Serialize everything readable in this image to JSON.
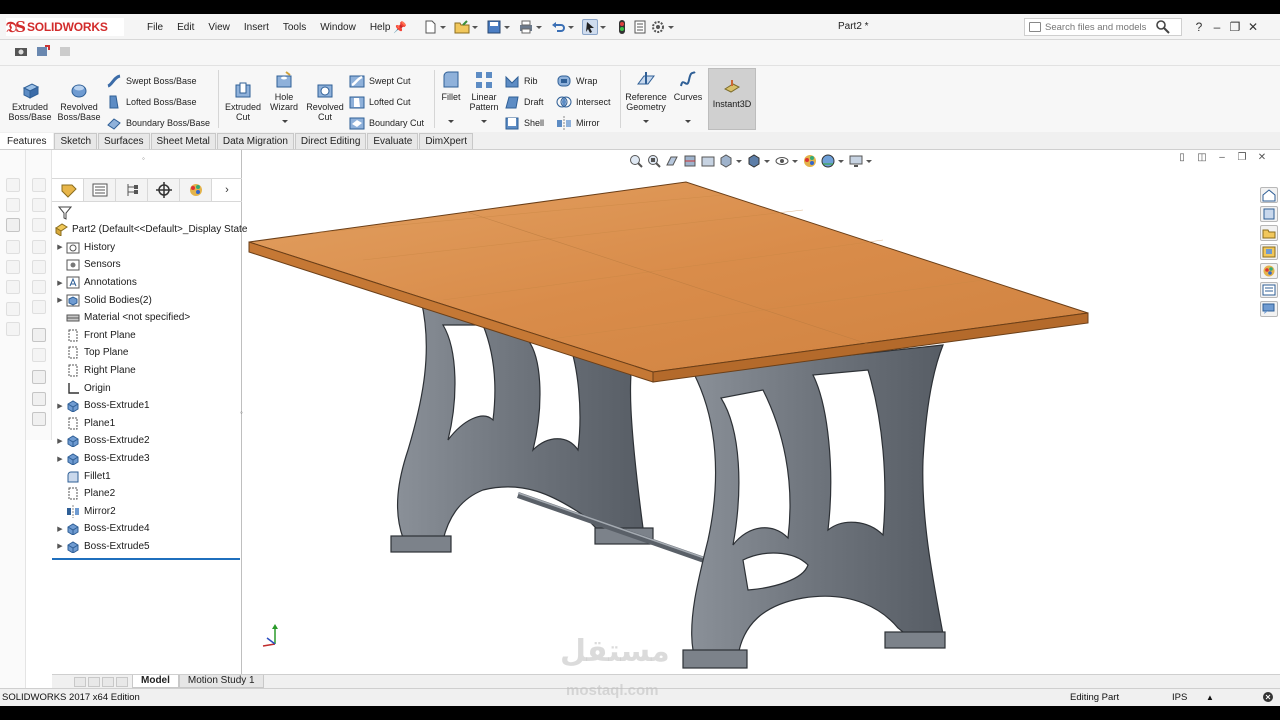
{
  "app": {
    "logo_text": "SOLIDWORKS",
    "document_title": "Part2 *"
  },
  "menu": [
    "File",
    "Edit",
    "View",
    "Insert",
    "Tools",
    "Window",
    "Help"
  ],
  "search": {
    "placeholder": "Search files and models"
  },
  "window_buttons": [
    "?",
    "–",
    "❐",
    "✕"
  ],
  "commands": {
    "extruded_boss": "Extruded Boss/Base",
    "revolved_boss": "Revolved Boss/Base",
    "swept_boss": "Swept Boss/Base",
    "lofted_boss": "Lofted Boss/Base",
    "boundary_boss": "Boundary Boss/Base",
    "extruded_cut": "Extruded Cut",
    "hole_wizard": "Hole Wizard",
    "revolved_cut": "Revolved Cut",
    "swept_cut": "Swept Cut",
    "lofted_cut": "Lofted Cut",
    "boundary_cut": "Boundary Cut",
    "fillet": "Fillet",
    "linear_pattern": "Linear Pattern",
    "rib": "Rib",
    "draft": "Draft",
    "shell": "Shell",
    "wrap": "Wrap",
    "intersect": "Intersect",
    "mirror": "Mirror",
    "reference_geometry": "Reference Geometry",
    "curves": "Curves",
    "instant3d": "Instant3D"
  },
  "tabs": [
    "Features",
    "Sketch",
    "Surfaces",
    "Sheet Metal",
    "Data Migration",
    "Direct Editing",
    "Evaluate",
    "DimXpert"
  ],
  "active_tab": "Features",
  "tree": {
    "root": "Part2  (Default<<Default>_Display State",
    "items": [
      {
        "label": "History",
        "expandable": true,
        "icon": "history-folder-icon"
      },
      {
        "label": "Sensors",
        "expandable": false,
        "icon": "sensor-icon"
      },
      {
        "label": "Annotations",
        "expandable": true,
        "icon": "annotation-icon"
      },
      {
        "label": "Solid Bodies(2)",
        "expandable": true,
        "icon": "solid-bodies-icon"
      },
      {
        "label": "Material <not specified>",
        "expandable": false,
        "icon": "material-icon"
      },
      {
        "label": "Front Plane",
        "expandable": false,
        "icon": "plane-icon"
      },
      {
        "label": "Top Plane",
        "expandable": false,
        "icon": "plane-icon"
      },
      {
        "label": "Right Plane",
        "expandable": false,
        "icon": "plane-icon"
      },
      {
        "label": "Origin",
        "expandable": false,
        "icon": "origin-icon"
      },
      {
        "label": "Boss-Extrude1",
        "expandable": true,
        "icon": "extrude-icon"
      },
      {
        "label": "Plane1",
        "expandable": false,
        "icon": "plane-icon"
      },
      {
        "label": "Boss-Extrude2",
        "expandable": true,
        "icon": "extrude-icon"
      },
      {
        "label": "Boss-Extrude3",
        "expandable": true,
        "icon": "extrude-icon"
      },
      {
        "label": "Fillet1",
        "expandable": false,
        "icon": "fillet-icon"
      },
      {
        "label": "Plane2",
        "expandable": false,
        "icon": "plane-icon"
      },
      {
        "label": "Mirror2",
        "expandable": false,
        "icon": "mirror-icon"
      },
      {
        "label": "Boss-Extrude4",
        "expandable": true,
        "icon": "extrude-icon"
      },
      {
        "label": "Boss-Extrude5",
        "expandable": true,
        "icon": "extrude-icon"
      }
    ]
  },
  "bottom_tabs": [
    "Model",
    "Motion Study 1"
  ],
  "status": {
    "edition": "SOLIDWORKS 2017 x64 Edition",
    "mode": "Editing Part",
    "units": "IPS"
  },
  "watermark": {
    "arabic": "مستقل",
    "latin": "mostaql.com"
  },
  "colors": {
    "brand_red": "#d22c2c",
    "accent_blue": "#1f6fbd",
    "table_top": "#d98c4a",
    "iron": "#6e747c"
  }
}
